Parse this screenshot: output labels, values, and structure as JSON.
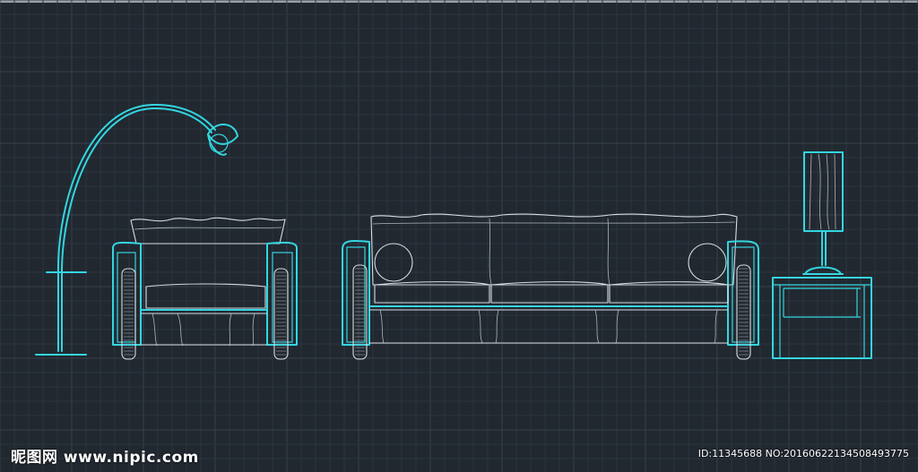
{
  "watermark": {
    "site": "昵图网 www.nipic.com",
    "id_text": "ID:11345688 NO:20160622134508493775"
  },
  "colors": {
    "background": "#212830",
    "grid": "#2c3540",
    "grid_major": "#37414d",
    "outline_cyan": "#33d6e0",
    "outline_white": "#d8dde2"
  },
  "drawing": {
    "objects": [
      "floor-lamp",
      "armchair",
      "three-seat-sofa",
      "side-table",
      "table-lamp"
    ]
  }
}
